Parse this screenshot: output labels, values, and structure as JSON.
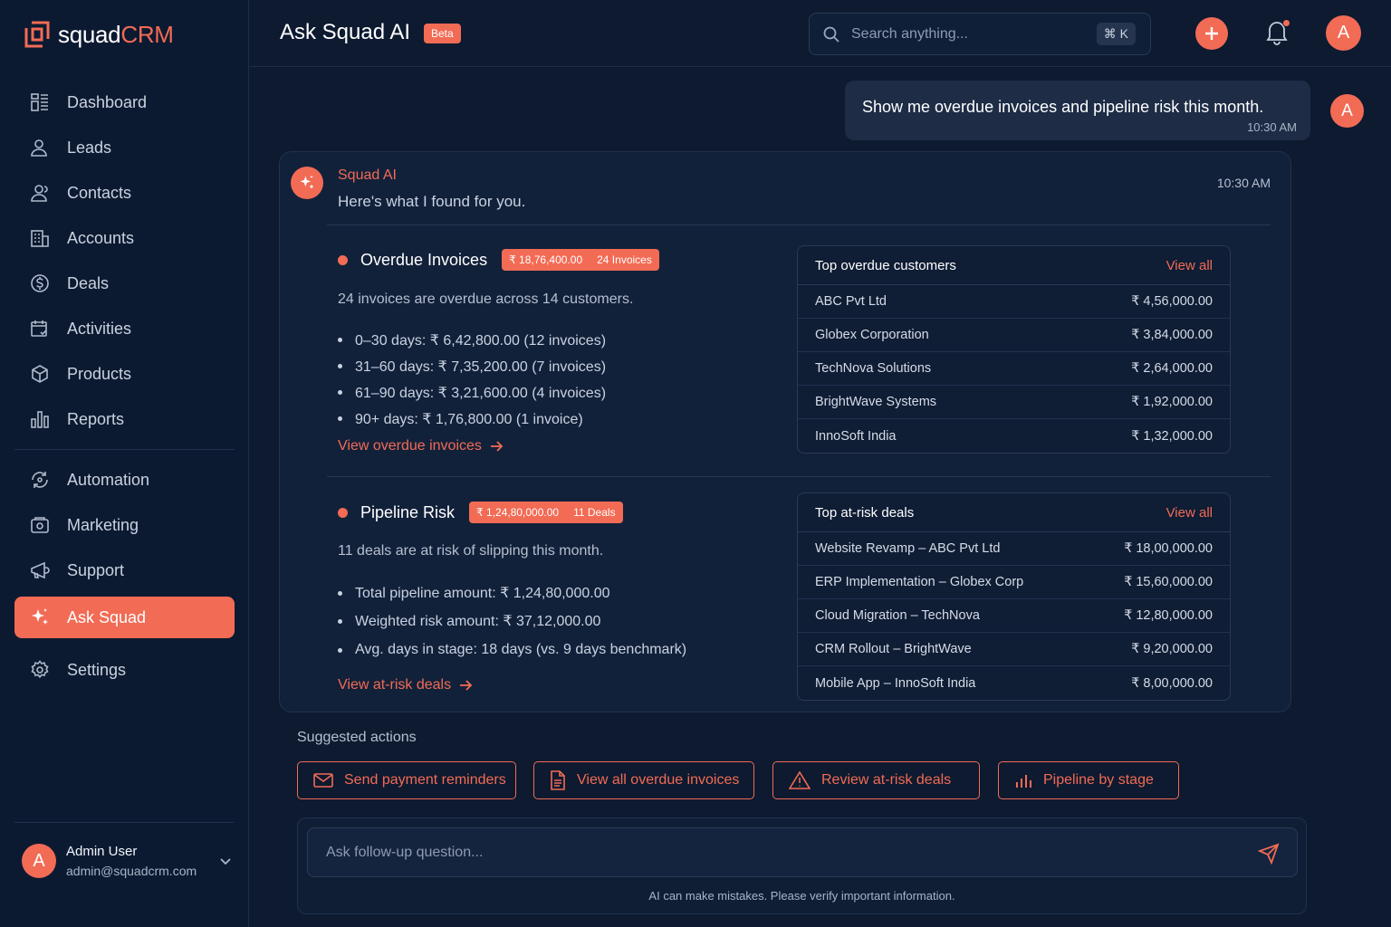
{
  "app": {
    "brand_part1": "squad",
    "brand_part2": "CRM",
    "accent_color": "#f26b55",
    "background_color": "#0d1a30"
  },
  "sidebar": {
    "items": [
      {
        "label": "Dashboard",
        "icon": "dashboard-icon"
      },
      {
        "label": "Leads",
        "icon": "leads-icon"
      },
      {
        "label": "Contacts",
        "icon": "contacts-icon"
      },
      {
        "label": "Accounts",
        "icon": "accounts-icon"
      },
      {
        "label": "Deals",
        "icon": "deals-icon"
      },
      {
        "label": "Activities",
        "icon": "activities-icon"
      },
      {
        "label": "Products",
        "icon": "products-icon"
      },
      {
        "label": "Reports",
        "icon": "reports-icon"
      },
      {
        "label": "Automation",
        "icon": "automation-icon"
      },
      {
        "label": "Marketing",
        "icon": "marketing-icon"
      },
      {
        "label": "Support",
        "icon": "support-icon"
      },
      {
        "label": "Ask Squad",
        "icon": "sparkle-icon",
        "active": true
      },
      {
        "label": "Settings",
        "icon": "gear-icon"
      }
    ],
    "user": {
      "initial": "A",
      "name": "Admin User",
      "email": "admin@squadcrm.com"
    }
  },
  "header": {
    "title": "Ask Squad AI",
    "badge": "Beta",
    "search_placeholder": "Search anything...",
    "shortcut": "⌘ K",
    "avatar_initial": "A"
  },
  "chat": {
    "user_message": {
      "text": "Show me overdue invoices and pipeline risk this month.",
      "time": "10:30 AM",
      "avatar_initial": "A"
    },
    "ai_message": {
      "sender": "Squad AI",
      "intro": "Here's what I found for you.",
      "time": "10:30 AM",
      "overdue": {
        "title": "Overdue Invoices",
        "badge_amount": "₹ 18,76,400.00",
        "badge_count": "24 Invoices",
        "description": "24 invoices are overdue across 14 customers.",
        "bullets": [
          "0–30 days: ₹ 6,42,800.00 (12 invoices)",
          "31–60 days: ₹ 7,35,200.00 (7 invoices)",
          "61–90 days: ₹ 3,21,600.00 (4 invoices)",
          "90+ days: ₹ 1,76,800.00 (1 invoice)"
        ],
        "link": "View overdue invoices",
        "table": {
          "title": "Top overdue customers",
          "view_all": "View all",
          "rows": [
            {
              "name": "ABC Pvt Ltd",
              "amount": "₹ 4,56,000.00"
            },
            {
              "name": "Globex Corporation",
              "amount": "₹ 3,84,000.00"
            },
            {
              "name": "TechNova Solutions",
              "amount": "₹ 2,64,000.00"
            },
            {
              "name": "BrightWave Systems",
              "amount": "₹ 1,92,000.00"
            },
            {
              "name": "InnoSoft India",
              "amount": "₹ 1,32,000.00"
            }
          ]
        }
      },
      "pipeline": {
        "title": "Pipeline Risk",
        "badge_amount": "₹ 1,24,80,000.00",
        "badge_count": "11 Deals",
        "description": "11 deals are at risk of slipping this month.",
        "bullets": [
          "Total pipeline amount: ₹ 1,24,80,000.00",
          "Weighted risk amount: ₹ 37,12,000.00",
          "Avg. days in stage: 18 days (vs. 9 days benchmark)"
        ],
        "link": "View at-risk deals",
        "table": {
          "title": "Top at-risk deals",
          "view_all": "View all",
          "rows": [
            {
              "name": "Website Revamp – ABC Pvt Ltd",
              "amount": "₹ 18,00,000.00"
            },
            {
              "name": "ERP Implementation – Globex Corp",
              "amount": "₹ 15,60,000.00"
            },
            {
              "name": "Cloud Migration – TechNova",
              "amount": "₹ 12,80,000.00"
            },
            {
              "name": "CRM Rollout – BrightWave",
              "amount": "₹ 9,20,000.00"
            },
            {
              "name": "Mobile App – InnoSoft India",
              "amount": "₹ 8,00,000.00"
            }
          ]
        }
      }
    }
  },
  "suggested": {
    "label": "Suggested actions",
    "actions": [
      {
        "label": "Send payment reminders",
        "icon": "mail-icon"
      },
      {
        "label": "View all overdue invoices",
        "icon": "document-icon"
      },
      {
        "label": "Review at-risk deals",
        "icon": "warning-icon"
      },
      {
        "label": "Pipeline by stage",
        "icon": "bar-chart-icon"
      }
    ]
  },
  "composer": {
    "placeholder": "Ask follow-up question...",
    "disclaimer": "AI can make mistakes. Please verify important information."
  }
}
